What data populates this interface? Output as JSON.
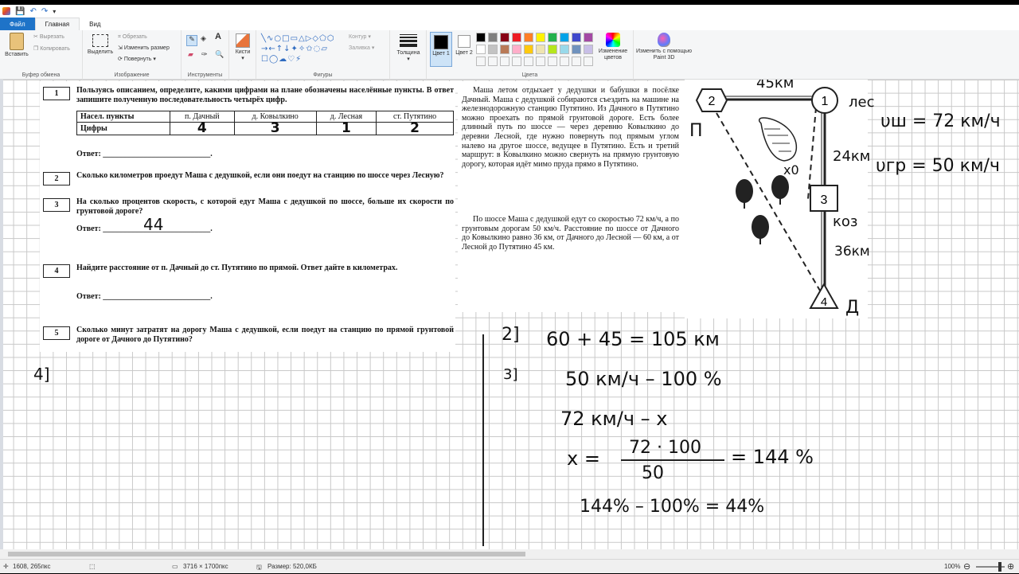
{
  "quick_access": {
    "save": "💾",
    "undo": "↶",
    "redo": "↷"
  },
  "tabs": [
    {
      "label": "Файл"
    },
    {
      "label": "Главная"
    },
    {
      "label": "Вид"
    }
  ],
  "ribbon": {
    "clipboard": {
      "paste": "Вставить",
      "cut": "Вырезать",
      "copy": "Копировать",
      "group": "Буфер обмена"
    },
    "image": {
      "select": "Выделить",
      "crop": "Обрезать",
      "resize": "Изменить размер",
      "rotate": "Повернуть",
      "group": "Изображение"
    },
    "tools": {
      "group": "Инструменты"
    },
    "brushes": {
      "label": "Кисти"
    },
    "shapes": {
      "outline": "Контур",
      "fill": "Заливка",
      "group": "Фигуры"
    },
    "size": {
      "label": "Толщина"
    },
    "color1": {
      "label": "Цвет 1"
    },
    "color2": {
      "label": "Цвет 2"
    },
    "colors": {
      "group": "Цвета",
      "edit": "Изменение цветов"
    },
    "paint3d": {
      "label": "Изменить с помощью Paint 3D"
    }
  },
  "palette": [
    "#000000",
    "#7f7f7f",
    "#880015",
    "#ed1c24",
    "#ff7f27",
    "#fff200",
    "#22b14c",
    "#00a2e8",
    "#3f48cc",
    "#a349a4",
    "#ffffff",
    "#c3c3c3",
    "#b97a57",
    "#ffaec9",
    "#ffc90e",
    "#efe4b0",
    "#b5e61d",
    "#99d9ea",
    "#7092be",
    "#c8bfe7"
  ],
  "doc": {
    "task1": {
      "num": "1",
      "text": "Пользуясь описанием, определите, какими цифрами на плане обозначены населённые пункты. В ответ запишите полученную последовательность четырёх цифр."
    },
    "table": {
      "headers": [
        "Насел. пункты",
        "п. Дачный",
        "д. Ковылкино",
        "д. Лесная",
        "ст. Путятино"
      ],
      "row_label": "Цифры"
    },
    "answer_label": "Ответ: ___________________________.",
    "task2": {
      "num": "2",
      "text": "Сколько километров проедут Маша с дедушкой, если они поедут на станцию по шоссе через Лесную?"
    },
    "task3": {
      "num": "3",
      "text": "На сколько процентов скорость, с которой едут Маша с дедушкой по шоссе, больше их скорости по грунтовой дороге?"
    },
    "task4": {
      "num": "4",
      "text": "Найдите расстояние от п. Дачный до ст. Путятино по прямой. Ответ дайте в километрах."
    },
    "task5": {
      "num": "5",
      "text": "Сколько минут затратят на дорогу Маша с дедушкой, если поедут на станцию по прямой грунтовой дороге от Дачного до Путятино?"
    },
    "story_p1": "Маша летом отдыхает у дедушки и бабушки в посёлке Дачный. Маша с дедушкой собираются съездить на машине на железнодорожную станцию Путятино. Из Дачного в Путятино можно проехать по прямой грунтовой дороге. Есть более длинный путь по шоссе — через деревню Ковылкино до деревни Лесной, где нужно повернуть под прямым углом налево на другое шоссе, ведущее в Путятино. Есть и третий маршрут: в Ковылкино можно свернуть на прямую грунтовую дорогу, которая идёт мимо пруда прямо в Путятино.",
    "story_p2": "По шоссе Маша с дедушкой едут со скоростью 72 км/ч, а по грунтовым дорогам 50 км/ч. Расстояние по шоссе от Дачного до Ковылкино равно 36 км, от Дачного до Лесной — 60 км, а от Лесной до Путятино 45 км."
  },
  "map": {
    "nodes": [
      "2",
      "1",
      "3",
      "4"
    ]
  },
  "handwriting": {
    "row_answers": [
      "4",
      "3",
      "1",
      "2"
    ],
    "ans3": "44",
    "top_km": "45км",
    "P": "П",
    "les": "лес",
    "v1": "υш = 72 км/ч",
    "v2": "υгр = 50 км/ч",
    "km24": "24км",
    "koz": "коз",
    "km36": "36км",
    "D": "Д",
    "x0": "x0",
    "left4": "4]",
    "l2": "2]",
    "eq2": "60 + 45 = 105 км",
    "l3": "3]",
    "eq3a": "50 км/ч – 100 %",
    "eq3b": "72 км/ч – x",
    "eq3c_x": "x =",
    "eq3c_num": "72 · 100",
    "eq3c_den": "50",
    "eq3c_res": "= 144 %",
    "eq3d": "144% – 100% = 44%"
  },
  "status": {
    "cursor": "1608, 265пкс",
    "dims": "3716 × 1700пкс",
    "size": "Размер: 520,0КБ",
    "zoom": "100%"
  }
}
